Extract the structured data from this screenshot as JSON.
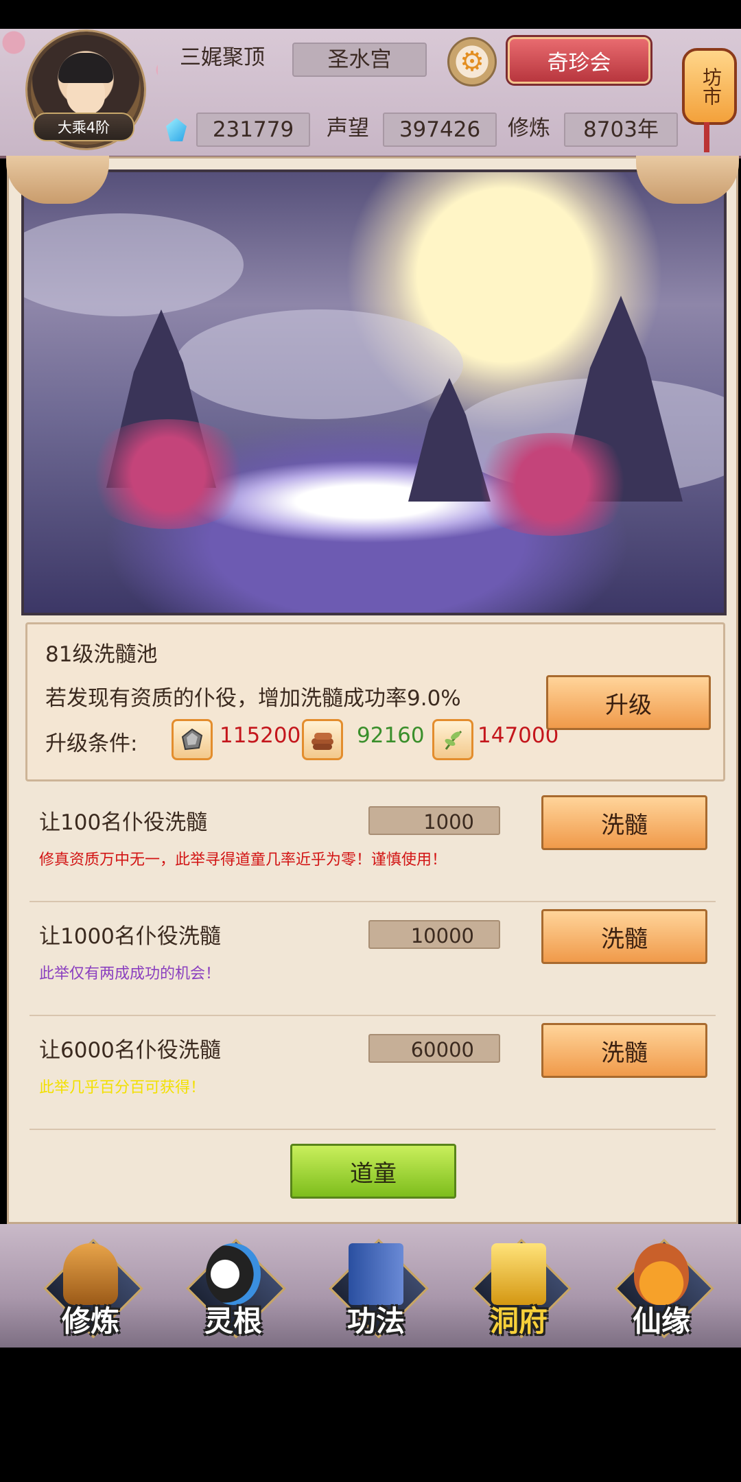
{
  "header": {
    "rank": "大乘4阶",
    "player_name": "三娓聚顶",
    "sect": "圣水宫",
    "treasure_button": "奇珍会",
    "market_label": "坊市",
    "spirit_stones": "231779",
    "reputation_label": "声望",
    "reputation": "397426",
    "cultivation_label": "修炼",
    "cultivation": "8703年"
  },
  "pool": {
    "title": "81级洗髓池",
    "description": "若发现有资质的仆役，增加洗髓成功率9.0%",
    "upgrade_button": "升级",
    "condition_label": "升级条件:",
    "resources": [
      {
        "icon": "ore-icon",
        "value": "115200",
        "color": "#c4161c"
      },
      {
        "icon": "wood-icon",
        "value": "92160",
        "color": "#3a8f2b"
      },
      {
        "icon": "herb-icon",
        "value": "147000",
        "color": "#c4161c"
      }
    ]
  },
  "options": [
    {
      "title": "让100名仆役洗髓",
      "cost": "1000",
      "hint": "修真资质万中无一，此举寻得道童几率近乎为零！谨慎使用！",
      "hint_color": "#d21414",
      "button": "洗髓"
    },
    {
      "title": "让1000名仆役洗髓",
      "cost": "10000",
      "hint": "此举仅有两成成功的机会！",
      "hint_color": "#8a3fbf",
      "button": "洗髓"
    },
    {
      "title": "让6000名仆役洗髓",
      "cost": "60000",
      "hint": "此举几乎百分百可获得！",
      "hint_color": "#f2e000",
      "button": "洗髓"
    }
  ],
  "daotong_button": "道童",
  "nav": {
    "items": [
      {
        "label": "修炼",
        "icon": "monk-icon",
        "active": false
      },
      {
        "label": "灵根",
        "icon": "taiji-sword-icon",
        "active": false
      },
      {
        "label": "功法",
        "icon": "book-icon",
        "active": false
      },
      {
        "label": "洞府",
        "icon": "golden-palace-icon",
        "active": true
      },
      {
        "label": "仙缘",
        "icon": "gourd-icon",
        "active": false
      }
    ]
  }
}
